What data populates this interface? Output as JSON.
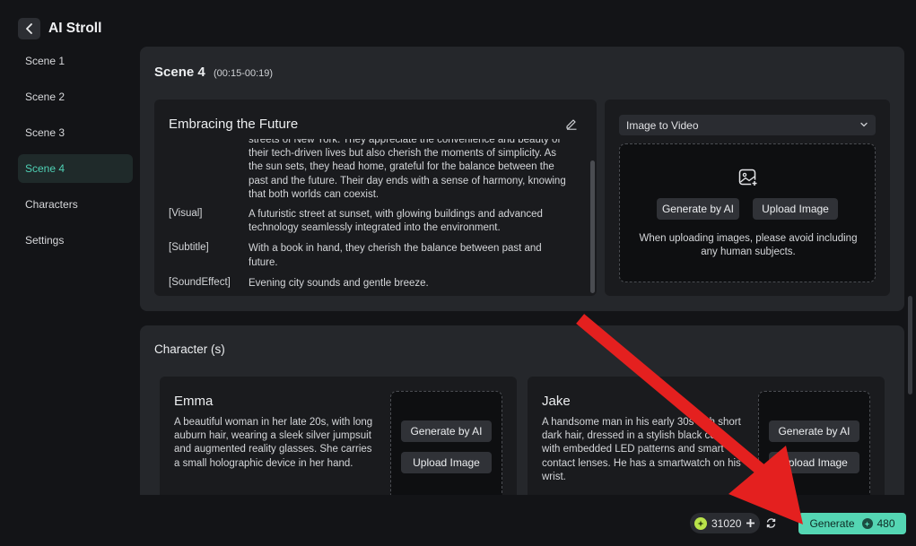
{
  "header": {
    "title": "AI Stroll"
  },
  "sidebar": {
    "items": [
      {
        "label": "Scene 1"
      },
      {
        "label": "Scene 2"
      },
      {
        "label": "Scene 3"
      },
      {
        "label": "Scene 4",
        "active": true
      },
      {
        "label": "Characters"
      },
      {
        "label": "Settings"
      }
    ]
  },
  "scene": {
    "title": "Scene 4",
    "time": "(00:15-00:19)",
    "script": {
      "heading": "Embracing the Future",
      "narration": "streets of New York. They appreciate the convenience and beauty of their tech-driven lives but also cherish the moments of simplicity. As the sun sets, they head home, grateful for the balance between the past and the future. Their day ends with a sense of harmony, knowing that both worlds can coexist.",
      "rows": [
        {
          "tag": "[Visual]",
          "text": "A futuristic street at sunset, with glowing buildings and advanced technology seamlessly integrated into the environment."
        },
        {
          "tag": "[Subtitle]",
          "text": "With a book in hand, they cherish the balance between past and future."
        },
        {
          "tag": "[SoundEffect]",
          "text": "Evening city sounds and gentle breeze."
        }
      ]
    },
    "media": {
      "mode": "Image to Video",
      "generate_label": "Generate by AI",
      "upload_label": "Upload Image",
      "note": "When uploading images, please avoid including any human subjects."
    }
  },
  "characters": {
    "title": "Character (s)",
    "items": [
      {
        "name": "Emma",
        "description": "A beautiful woman in her late 20s, with long auburn hair, wearing a sleek silver jumpsuit and augmented reality glasses. She carries a small holographic device in her hand.",
        "generate_label": "Generate by AI",
        "upload_label": "Upload Image"
      },
      {
        "name": "Jake",
        "description": "A handsome man in his early 30s with short dark hair, dressed in a stylish black coat with embedded LED patterns and smart contact lenses. He has a smartwatch on his wrist.",
        "generate_label": "Generate by AI",
        "upload_label": "Upload Image"
      }
    ]
  },
  "footer": {
    "credits": "31020",
    "generate_label": "Generate",
    "generate_cost": "480"
  },
  "colors": {
    "accent": "#54d6b3",
    "active_nav_text": "#4fd1b5",
    "arrow": "#e4201f",
    "coin": "#b9e34a"
  }
}
